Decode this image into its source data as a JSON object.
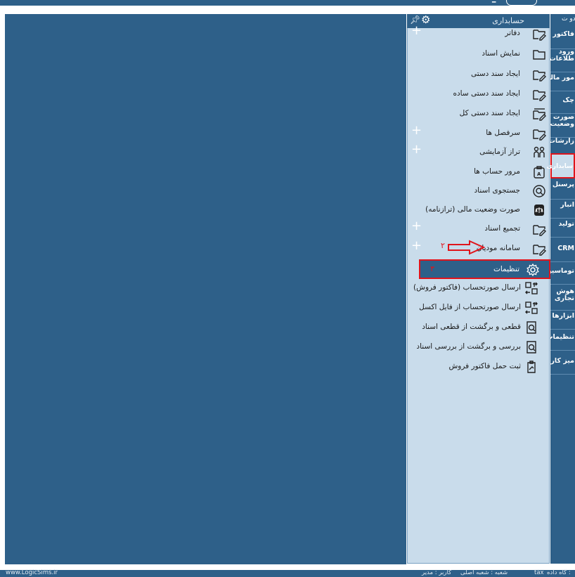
{
  "topbar": {
    "logo_mark": "━"
  },
  "panel": {
    "title": "حسابداری",
    "pin_icon": "pin-icon",
    "gear_icon": "gear-icon",
    "items": [
      {
        "label": "دفاتر",
        "icon": "folder-edit-icon",
        "expandable": true
      },
      {
        "label": "نمایش اسناد",
        "icon": "folder-icon",
        "expandable": false
      },
      {
        "label": "ایجاد سند دستی",
        "icon": "folder-edit-icon",
        "expandable": false
      },
      {
        "label": "ایجاد سند دستی ساده",
        "icon": "folder-edit-icon",
        "expandable": false
      },
      {
        "label": "ایجاد سند دستی کل",
        "icon": "folder-multi-edit-icon",
        "expandable": false
      },
      {
        "label": "سرفصل ها",
        "icon": "folder-edit-icon",
        "expandable": true
      },
      {
        "label": "تراز آزمایشی",
        "icon": "scale-icon",
        "expandable": true
      },
      {
        "label": "مرور حساب ها",
        "icon": "account-review-icon",
        "expandable": false
      },
      {
        "label": "جستجوی اسناد",
        "icon": "search-document-icon",
        "expandable": false
      },
      {
        "label": "صورت وضعیت مالی (ترازنامه)",
        "icon": "balance-sheet-icon",
        "expandable": false
      },
      {
        "label": "تجمیع اسناد",
        "icon": "folder-edit-icon",
        "expandable": true
      },
      {
        "label": "سامانه مودیان",
        "icon": "folder-edit-icon",
        "expandable": true
      }
    ],
    "settings": {
      "label": "تنظیمات",
      "icon": "gear-icon",
      "badge": "۳"
    },
    "arrow_badge": "۲",
    "sub_items": [
      {
        "label": "ارسال صورتحساب (فاکتور فروش)",
        "icon": "transfer-icon"
      },
      {
        "label": "ارسال صورتحساب از فایل اکسل",
        "icon": "transfer-icon"
      },
      {
        "label": "قطعی و برگشت از قطعی اسناد",
        "icon": "doc-search-icon"
      },
      {
        "label": "بررسی و برگشت از بررسی اسناد",
        "icon": "doc-search-icon"
      },
      {
        "label": "ثبت حمل فاکتور فروش",
        "icon": "clipboard-icon"
      }
    ]
  },
  "sidebar": {
    "top_label": "دو ت",
    "items": [
      {
        "label": "فاکتور"
      },
      {
        "label": "ورود\nطلاعات"
      },
      {
        "label": "مور مالی"
      },
      {
        "label": "چک"
      },
      {
        "label": "صورت\nوضعیت"
      },
      {
        "label": "زارشات"
      },
      {
        "label": "سابداری",
        "active": true
      },
      {
        "label": "پرسنل"
      },
      {
        "label": "انبار"
      },
      {
        "label": "تولید"
      },
      {
        "label": "CRM"
      },
      {
        "label": "توماسیون"
      },
      {
        "label": "هوش\nتجاری"
      },
      {
        "label": "ابزارها"
      },
      {
        "label": "تنظیمات"
      },
      {
        "label": "میز کار"
      }
    ]
  },
  "statusbar": {
    "website": "www.LogicSims.ir",
    "branch": "شعبه : شعبه اصلی",
    "user": "کاربر : مدیر",
    "database_value": "tax",
    "database_label": "گاه داده :"
  },
  "colors": {
    "brand_blue": "#2e6089",
    "panel_bg": "#c9dceb",
    "highlight_red": "#e0141b"
  }
}
